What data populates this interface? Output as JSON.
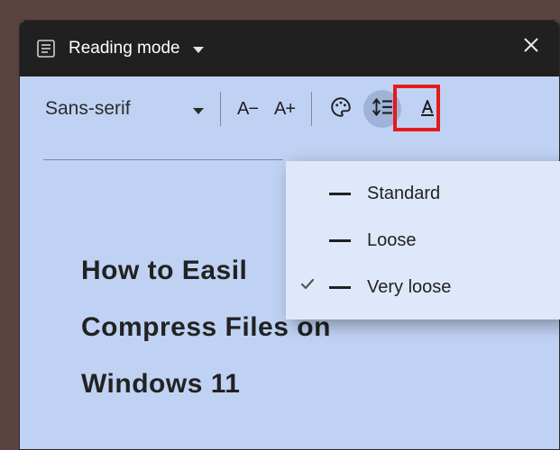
{
  "titlebar": {
    "mode_label": "Reading mode"
  },
  "toolbar": {
    "font_label": "Sans-serif",
    "decrease_label": "A−",
    "increase_label": "A+"
  },
  "line_spacing_menu": {
    "items": [
      {
        "label": "Standard",
        "checked": false,
        "density": "standard"
      },
      {
        "label": "Loose",
        "checked": false,
        "density": "loose"
      },
      {
        "label": "Very loose",
        "checked": true,
        "density": "veryloose"
      }
    ]
  },
  "article": {
    "title_line1": "How to Easil",
    "title_line2": "Compress Files on",
    "title_line3": "Windows 11"
  }
}
